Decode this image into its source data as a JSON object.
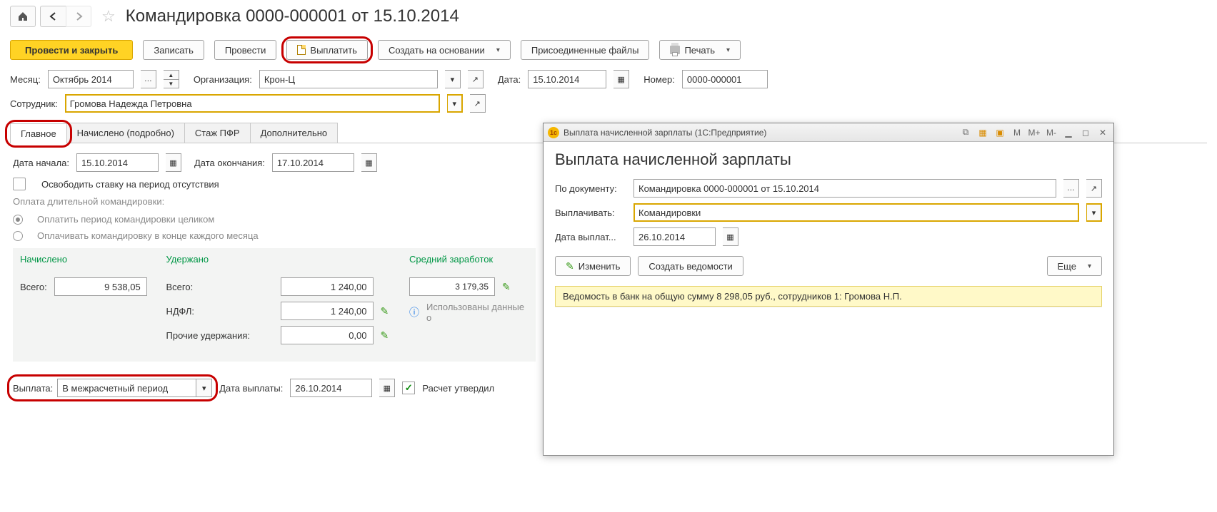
{
  "title": "Командировка 0000-000001 от 15.10.2014",
  "toolbar": {
    "post_close": "Провести и закрыть",
    "save": "Записать",
    "post": "Провести",
    "pay": "Выплатить",
    "create_based": "Создать на основании",
    "attached": "Присоединенные файлы",
    "print": "Печать"
  },
  "fields": {
    "month_lbl": "Месяц:",
    "month_val": "Октябрь 2014",
    "org_lbl": "Организация:",
    "org_val": "Крон-Ц",
    "date_lbl": "Дата:",
    "date_val": "15.10.2014",
    "num_lbl": "Номер:",
    "num_val": "0000-000001",
    "emp_lbl": "Сотрудник:",
    "emp_val": "Громова Надежда Петровна"
  },
  "tabs": [
    "Главное",
    "Начислено (подробно)",
    "Стаж ПФР",
    "Дополнительно"
  ],
  "main": {
    "start_lbl": "Дата начала:",
    "start_val": "15.10.2014",
    "end_lbl": "Дата окончания:",
    "end_val": "17.10.2014",
    "release": "Освободить ставку на период отсутствия",
    "longtrip_hdr": "Оплата длительной командировки:",
    "opt_full": "Оплатить период командировки целиком",
    "opt_monthly": "Оплачивать командировку в конце каждого месяца",
    "accrued_hdr": "Начислено",
    "withheld_hdr": "Удержано",
    "avg_hdr": "Средний заработок",
    "total_lbl": "Всего:",
    "accrued_total": "9 538,05",
    "withheld_total": "1 240,00",
    "ndfl_lbl": "НДФЛ:",
    "ndfl_val": "1 240,00",
    "other_lbl": "Прочие удержания:",
    "other_val": "0,00",
    "avg_val": "3 179,35",
    "avg_hint": "Использованы данные о",
    "pay_lbl": "Выплата:",
    "pay_mode": "В межрасчетный период",
    "paydate_lbl": "Дата выплаты:",
    "paydate_val": "26.10.2014",
    "approved": "Расчет утвердил"
  },
  "popup": {
    "wintitle": "Выплата начисленной зарплаты  (1С:Предприятие)",
    "heading": "Выплата начисленной зарплаты",
    "bydoc_lbl": "По документу:",
    "bydoc_val": "Командировка 0000-000001 от 15.10.2014",
    "paywhat_lbl": "Выплачивать:",
    "paywhat_val": "Командировки",
    "paydate_lbl": "Дата выплат...",
    "paydate_val": "26.10.2014",
    "edit_btn": "Изменить",
    "create_btn": "Создать ведомости",
    "more_btn": "Еще",
    "notice": "Ведомость в банк на общую сумму 8 298,05 руб., сотрудников 1: Громова Н.П.",
    "rtb": [
      "M",
      "M+",
      "M-"
    ]
  }
}
